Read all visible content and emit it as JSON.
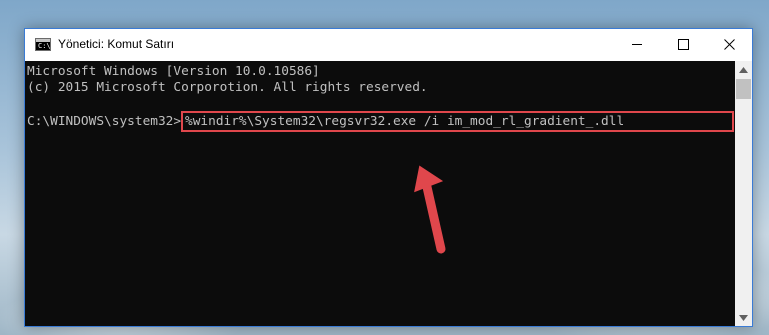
{
  "window": {
    "title": "Yönetici: Komut Satırı",
    "icon": "cmd-icon",
    "icon_prompt": "C:\\"
  },
  "controls": {
    "minimize_icon": "minimize-icon",
    "maximize_icon": "maximize-icon",
    "close_icon": "close-icon"
  },
  "console": {
    "lines": [
      "Microsoft Windows [Version 10.0.10586]",
      "(c) 2015 Microsoft Corporotion. All rights reserved."
    ],
    "prompt": "C:\\WINDOWS\\system32>",
    "command": "%windir%\\System32\\regsvr32.exe /i im_mod_rl_gradient_.dll",
    "text_color": "#c0c0c0",
    "background": "#0c0c0c"
  },
  "annotation": {
    "highlight_color": "#e0474c",
    "arrow_color": "#e0474c",
    "arrow_icon": "red-arrow-icon"
  },
  "scrollbar": {
    "up_icon": "scroll-up-icon",
    "down_icon": "scroll-down-icon"
  }
}
